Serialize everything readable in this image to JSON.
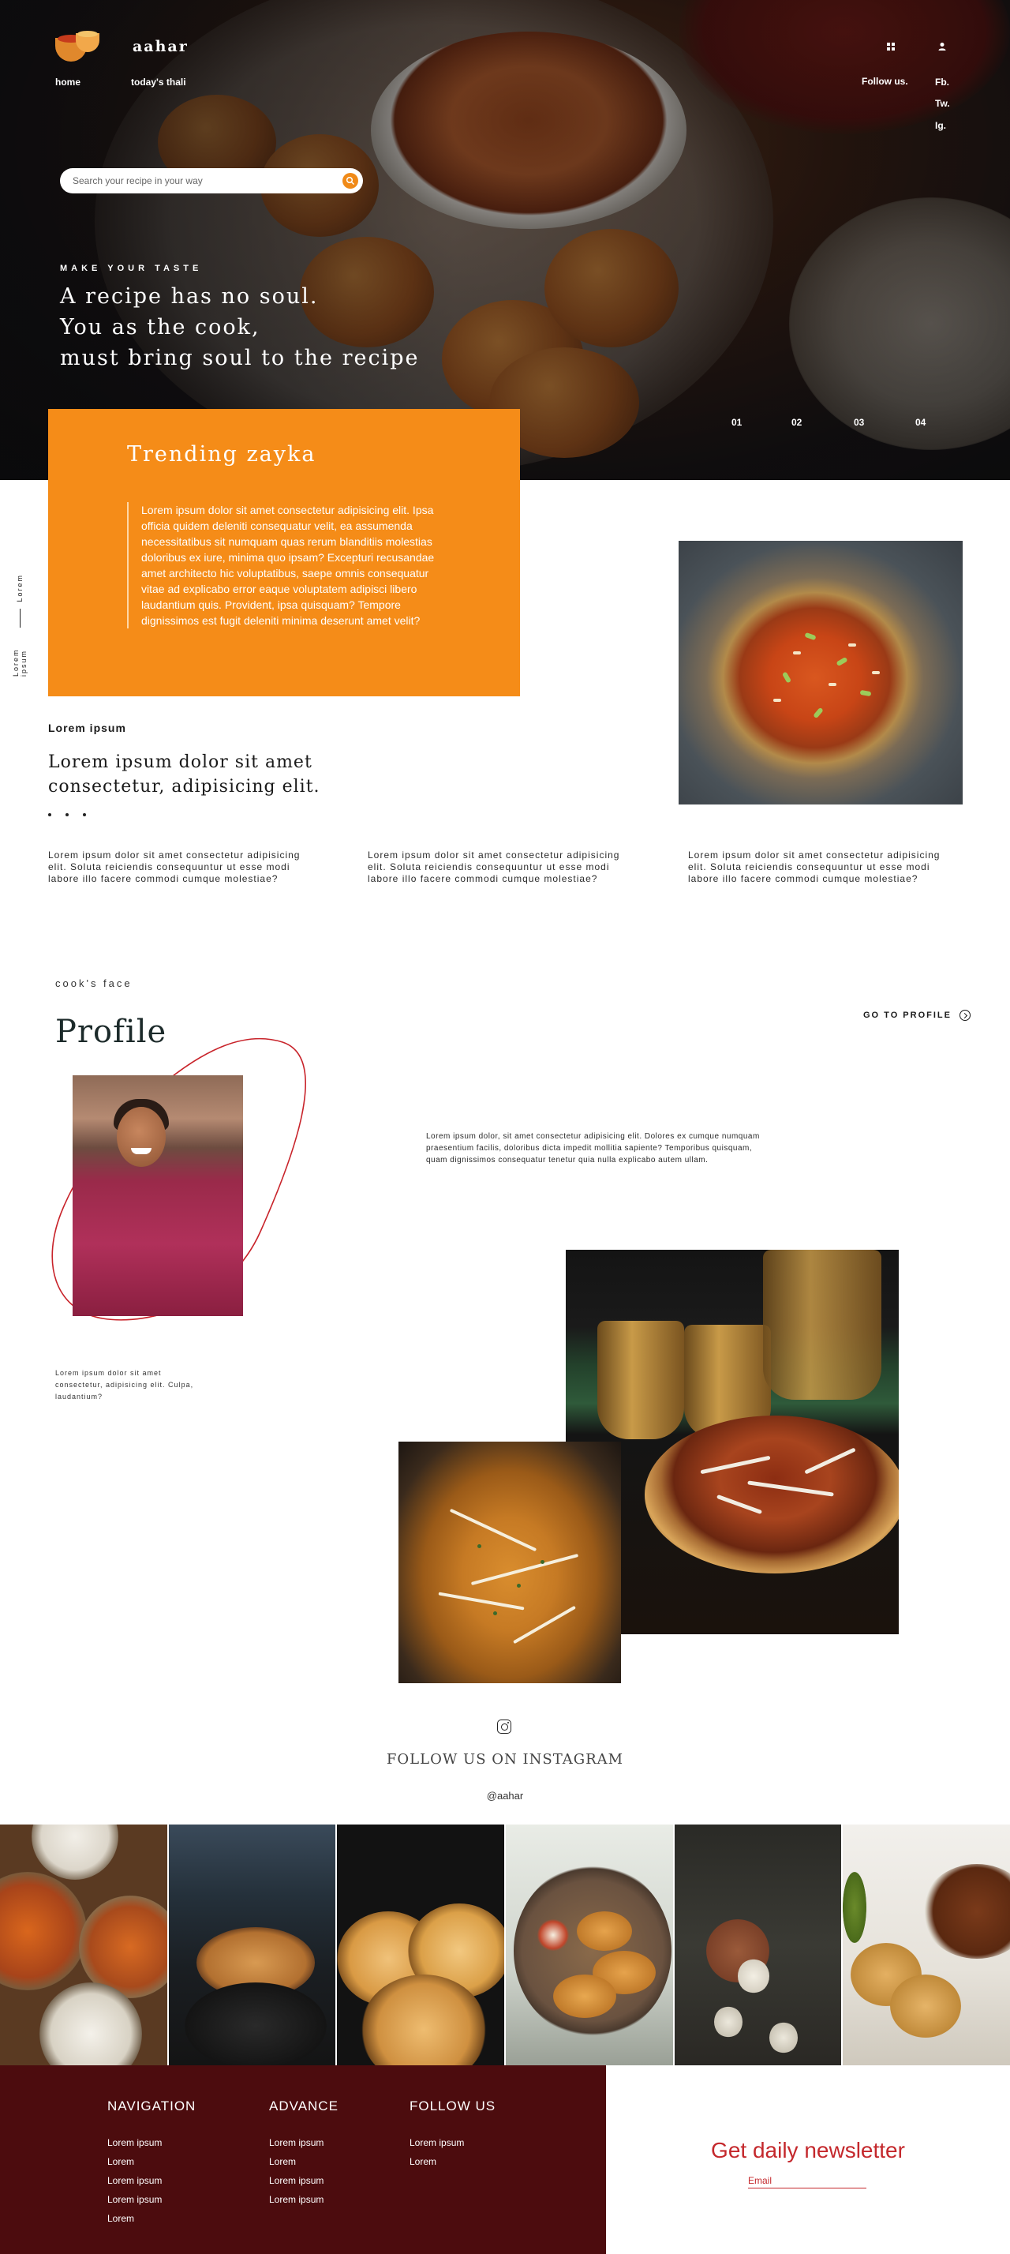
{
  "header": {
    "brand": "aahar",
    "nav": [
      "home",
      "today's thali"
    ],
    "follow_label": "Follow us.",
    "social": [
      "Fb.",
      "Tw.",
      "Ig."
    ]
  },
  "hero": {
    "search_placeholder": "Search your recipe in your way",
    "kicker": "MAKE YOUR TASTE",
    "tagline": [
      "A recipe has no soul.",
      "You as the cook,",
      "must bring soul to the recipe"
    ],
    "slides": [
      "01",
      "02",
      "03",
      "04"
    ]
  },
  "trending": {
    "title": "Trending zayka",
    "text": "Lorem ipsum dolor sit amet consectetur adipisicing elit. Ipsa officia quidem deleniti consequatur velit, ea assumenda necessitatibus sit numquam quas rerum blanditiis molestias doloribus ex iure, minima quo ipsam? Excepturi recusandae amet architecto hic voluptatibus, saepe omnis consequatur vitae ad explicabo error eaque voluptatem adipisci libero laudantium quis. Provident, ipsa quisquam? Tempore dignissimos est fugit deleniti minima deserunt amet velit?"
  },
  "side_label": {
    "a": "Lorem ipsum",
    "b": "Lorem"
  },
  "intro": {
    "kicker": "Lorem ipsum",
    "title": "Lorem ipsum dolor sit amet consectetur, adipisicing elit.",
    "columns": [
      "Lorem ipsum dolor sit amet consectetur adipisicing elit. Soluta reiciendis consequuntur ut esse modi labore illo facere commodi cumque molestiae?",
      "Lorem ipsum dolor sit amet consectetur adipisicing elit. Soluta reiciendis consequuntur ut esse modi labore illo facere commodi cumque molestiae?",
      "Lorem ipsum dolor sit amet consectetur adipisicing elit. Soluta reiciendis consequuntur ut esse modi labore illo facere commodi cumque molestiae?"
    ]
  },
  "profile": {
    "kicker": "cook's face",
    "title": "Profile",
    "goto_label": "GO TO PROFILE",
    "small_text": "Lorem ipsum dolor sit amet consectetur, adipisicing elit. Culpa, laudantium?",
    "text": "Lorem ipsum dolor, sit amet consectetur adipisicing elit. Dolores ex cumque numquam praesentium facilis, doloribus dicta impedit mollitia sapiente? Temporibus quisquam, quam dignissimos consequatur tenetur quia nulla explicabo autem ullam."
  },
  "instagram": {
    "title": "FOLLOW US ON INSTAGRAM",
    "handle": "@aahar"
  },
  "footer": {
    "navigation": {
      "title": "NAVIGATION",
      "links": [
        "Lorem ipsum",
        "Lorem",
        "Lorem ipsum",
        "Lorem ipsum",
        "Lorem"
      ]
    },
    "advance": {
      "title": "ADVANCE",
      "links": [
        "Lorem ipsum",
        "Lorem",
        "Lorem ipsum",
        "Lorem ipsum"
      ]
    },
    "follow": {
      "title": "FOLLOW US",
      "links": [
        "Lorem ipsum",
        "Lorem"
      ]
    },
    "newsletter": {
      "title": "Get daily newsletter",
      "email_placeholder": "Email"
    }
  },
  "colors": {
    "accent_orange": "#f58c18",
    "footer_maroon": "#4c0c0e",
    "newsletter_red": "#c4282c"
  }
}
